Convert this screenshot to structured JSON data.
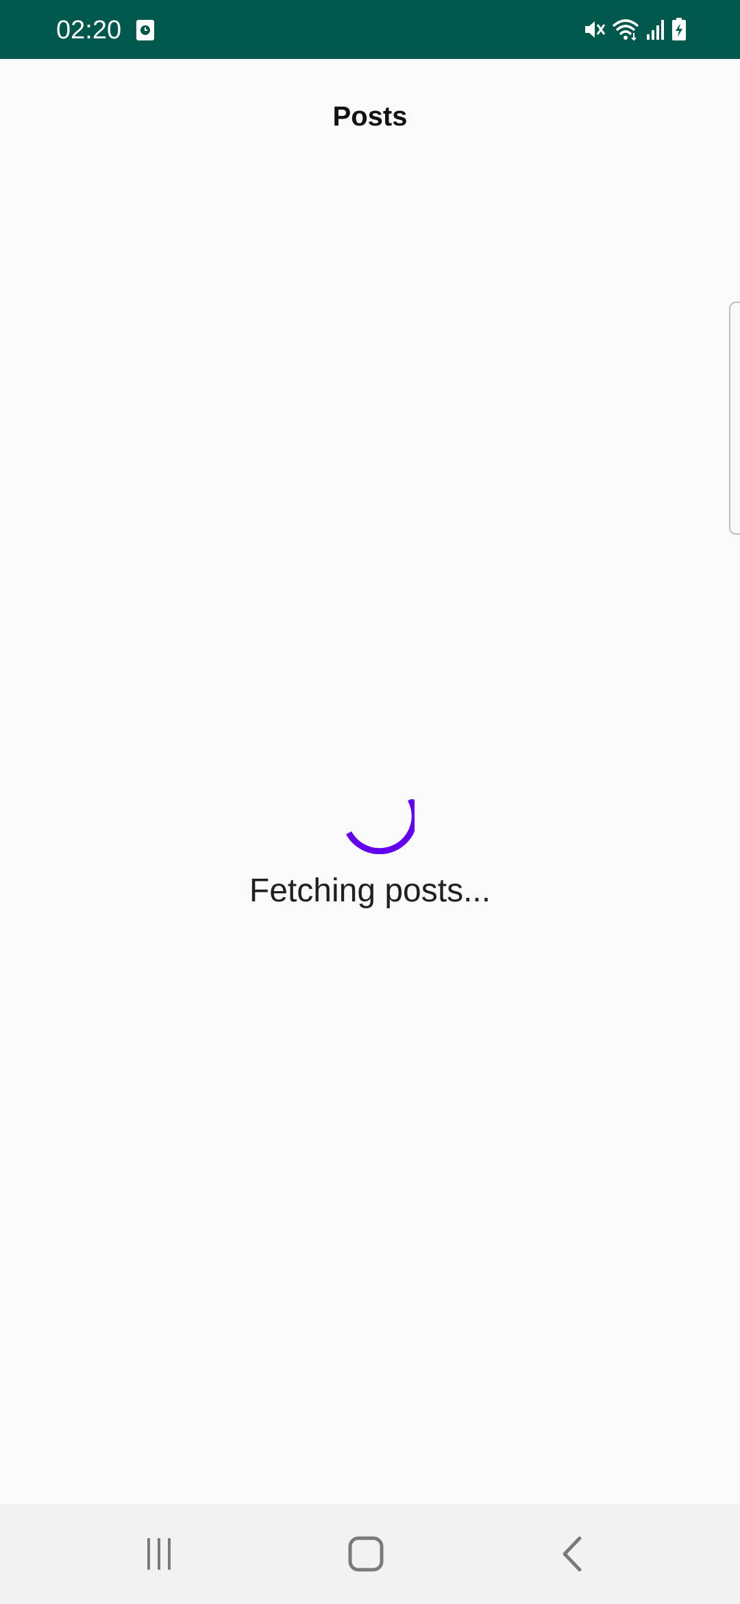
{
  "status_bar": {
    "time": "02:20",
    "left_icon": "screen-time-icon",
    "icons": [
      "mute-icon",
      "wifi-icon",
      "signal-icon",
      "battery-charging-icon"
    ],
    "background_color": "#00574b"
  },
  "app_bar": {
    "title": "Posts"
  },
  "loading": {
    "message": "Fetching posts...",
    "spinner_color": "#6200ee"
  },
  "nav_bar": {
    "buttons": [
      "recents-icon",
      "home-icon",
      "back-icon"
    ]
  }
}
